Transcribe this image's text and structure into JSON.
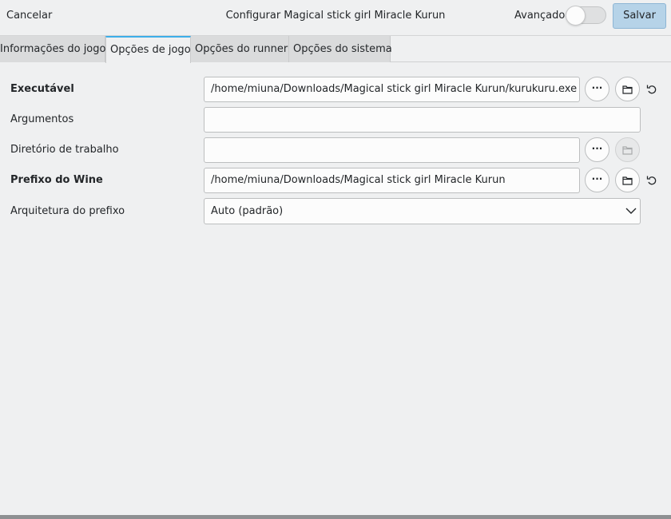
{
  "header": {
    "cancel_label": "Cancelar",
    "title": "Configurar Magical stick girl Miracle Kurun",
    "advanced_label": "Avançado",
    "advanced_enabled": false,
    "save_label": "Salvar"
  },
  "tabs": [
    {
      "label": "Informações do jogo",
      "active": false
    },
    {
      "label": "Opções de jogo",
      "active": true
    },
    {
      "label": "Opções do runner",
      "active": false
    },
    {
      "label": "Opções do sistema",
      "active": false
    }
  ],
  "form": {
    "executable": {
      "label": "Executável",
      "value": "/home/miuna/Downloads/Magical stick girl Miracle Kurun/kurukuru.exe"
    },
    "arguments": {
      "label": "Argumentos",
      "value": ""
    },
    "working_dir": {
      "label": "Diretório de trabalho",
      "value": ""
    },
    "wine_prefix": {
      "label": "Prefixo do Wine",
      "value": "/home/miuna/Downloads/Magical stick girl Miracle Kurun"
    },
    "prefix_arch": {
      "label": "Arquitetura do prefixo",
      "value": "Auto (padrão)"
    }
  },
  "buttons": {
    "browse_symbol": "···"
  },
  "colors": {
    "accent": "#3daee9",
    "save_bg": "#b6d3e8",
    "window_bg": "#eff0f1"
  }
}
